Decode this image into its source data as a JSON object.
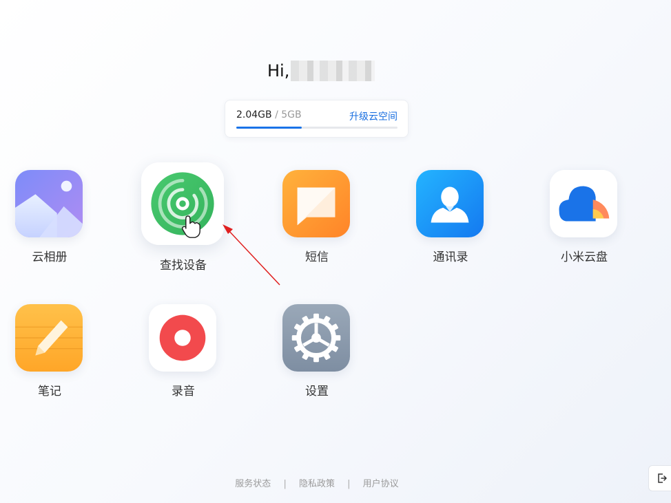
{
  "header": {
    "greeting": "Hi,"
  },
  "storage": {
    "used": "2.04GB",
    "separator": "/",
    "total": "5GB",
    "upgrade_label": "升级云空间",
    "usage_fraction": 0.408,
    "accent": "#1a73e8"
  },
  "apps": [
    {
      "label": "云相册",
      "icon": "gallery-icon",
      "color": "#8b8cf5"
    },
    {
      "label": "查找设备",
      "icon": "find-device-icon",
      "color": "#3dbb63"
    },
    {
      "label": "短信",
      "icon": "sms-icon",
      "color": "#ff9a2e"
    },
    {
      "label": "通讯录",
      "icon": "contacts-icon",
      "color": "#1a9af5"
    },
    {
      "label": "小米云盘",
      "icon": "cloud-drive-icon",
      "color": "#1a73e8"
    },
    {
      "label": "笔记",
      "icon": "notes-icon",
      "color": "#ffb43c"
    },
    {
      "label": "录音",
      "icon": "recorder-icon",
      "color": "#f24a4d"
    },
    {
      "label": "设置",
      "icon": "settings-icon",
      "color": "#8c9cae"
    }
  ],
  "footer": {
    "links": [
      "服务状态",
      "隐私政策",
      "用户协议"
    ],
    "separator": "|"
  },
  "logout": {
    "icon": "logout-icon"
  }
}
